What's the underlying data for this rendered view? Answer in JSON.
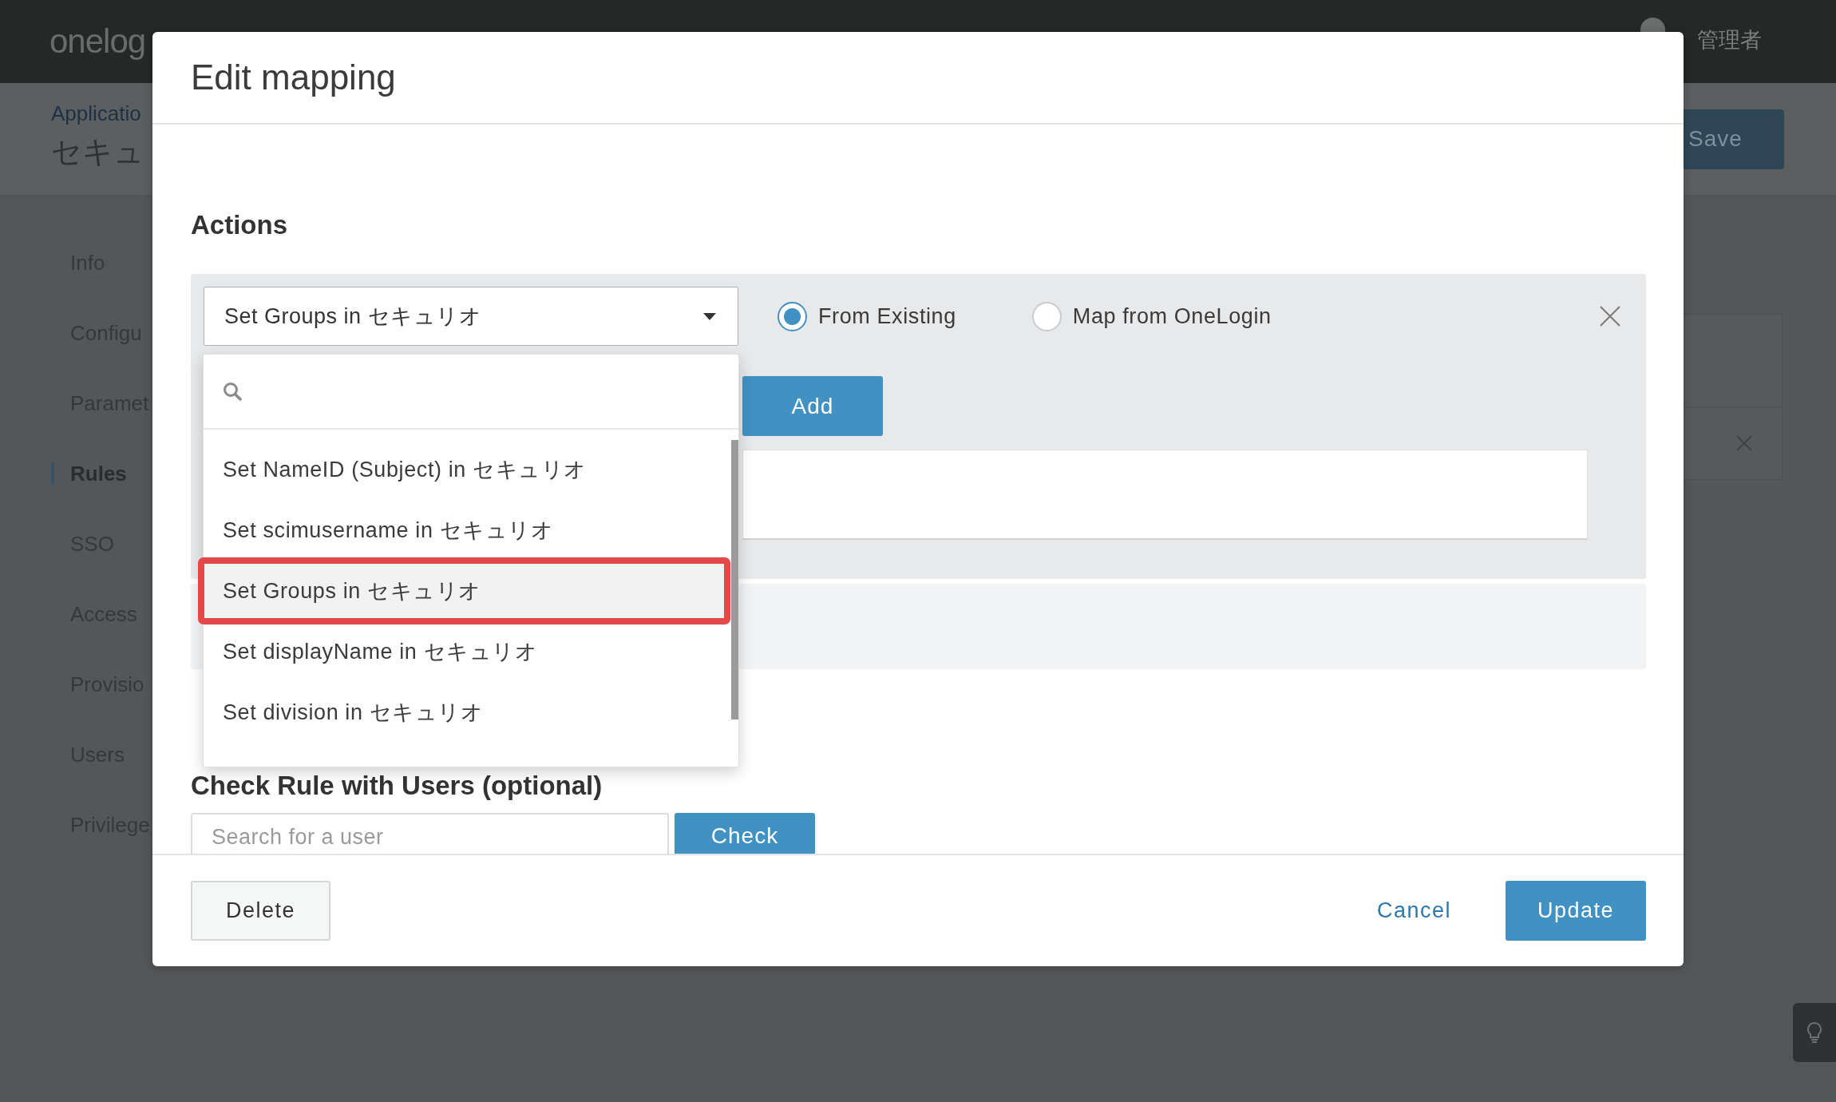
{
  "app_header": {
    "logo": "onelog",
    "user_name": "管理者"
  },
  "page_header": {
    "breadcrumb": "Applicatio",
    "title": "セキュ",
    "save_button": "Save"
  },
  "sidebar": {
    "items": [
      {
        "label": "Info",
        "selected": false
      },
      {
        "label": "Configu",
        "selected": false
      },
      {
        "label": "Paramet",
        "selected": false
      },
      {
        "label": "Rules",
        "selected": true
      },
      {
        "label": "SSO",
        "selected": false
      },
      {
        "label": "Access",
        "selected": false
      },
      {
        "label": "Provisio",
        "selected": false
      },
      {
        "label": "Users",
        "selected": false
      },
      {
        "label": "Privilege",
        "selected": false
      }
    ]
  },
  "dialog": {
    "title": "Edit mapping",
    "actions_heading": "Actions",
    "action": {
      "select": {
        "value": "Set Groups in セキュリオ",
        "expanded": true,
        "options": [
          {
            "label": "Set NameID (Subject) in セキュリオ",
            "selected": false,
            "highlighted": false
          },
          {
            "label": "Set scimusername in セキュリオ",
            "selected": false,
            "highlighted": false
          },
          {
            "label": "Set Groups in セキュリオ",
            "selected": true,
            "highlighted": true
          },
          {
            "label": "Set displayName in セキュリオ",
            "selected": false,
            "highlighted": false
          },
          {
            "label": "Set division in セキュリオ",
            "selected": false,
            "highlighted": false
          }
        ]
      },
      "radios": [
        {
          "label": "From Existing",
          "selected": true
        },
        {
          "label": "Map from OneLogin",
          "selected": false
        }
      ],
      "add_button": "Add"
    },
    "check_heading": "Check Rule with Users (optional)",
    "user_search": {
      "placeholder": "Search for a user"
    },
    "check_button": "Check",
    "buttons": [
      {
        "label": "Delete",
        "kind": "secondary"
      },
      {
        "label": "Cancel",
        "kind": "link"
      },
      {
        "label": "Update",
        "kind": "primary"
      }
    ]
  }
}
